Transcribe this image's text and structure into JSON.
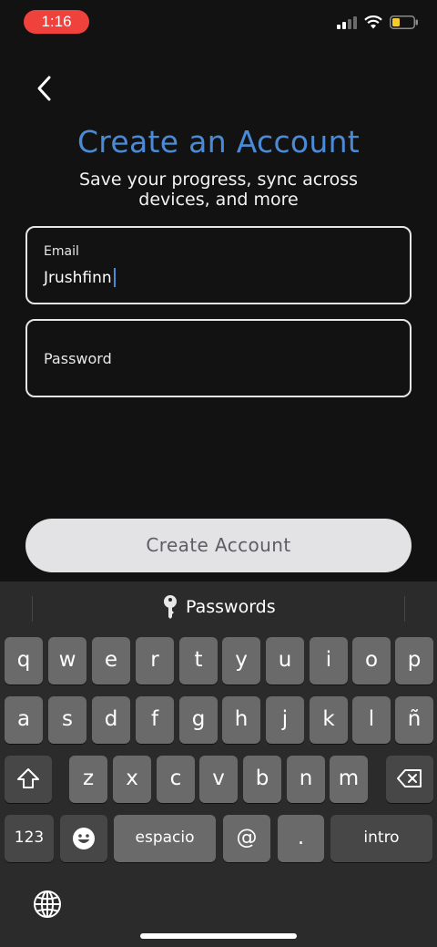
{
  "status_bar": {
    "time": "1:16",
    "icons": [
      "signal-icon",
      "wifi-icon",
      "battery-icon"
    ],
    "pill_color": "#f0423c"
  },
  "header": {
    "back_icon": "chevron-left-icon",
    "title": "Create an Account",
    "subtitle": "Save your progress, sync across devices, and more",
    "title_color": "#4b8ad6"
  },
  "form": {
    "email": {
      "label": "Email",
      "value": "Jrushfinn"
    },
    "password": {
      "label": "Password",
      "value": ""
    },
    "submit_label": "Create Account"
  },
  "keyboard": {
    "suggestion": "Passwords",
    "suggestion_icon": "key-icon",
    "rows": [
      [
        "q",
        "w",
        "e",
        "r",
        "t",
        "y",
        "u",
        "i",
        "o",
        "p"
      ],
      [
        "a",
        "s",
        "d",
        "f",
        "g",
        "h",
        "j",
        "k",
        "l",
        "ñ"
      ],
      [
        "z",
        "x",
        "c",
        "v",
        "b",
        "n",
        "m"
      ]
    ],
    "shift_icon": "shift-icon",
    "delete_icon": "backspace-icon",
    "numbers_label": "123",
    "emoji_icon": "emoji-icon",
    "space_label": "espacio",
    "at_label": "@",
    "dot_label": ".",
    "return_label": "intro",
    "globe_icon": "globe-icon"
  }
}
